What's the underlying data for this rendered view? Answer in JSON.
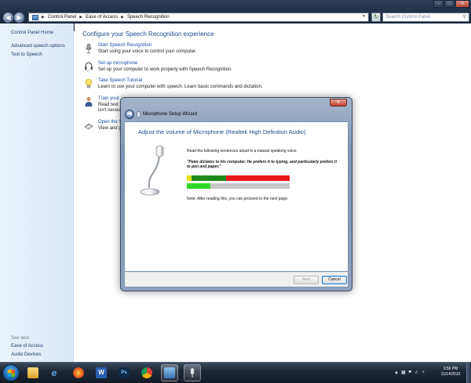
{
  "window": {
    "breadcrumb": [
      "Control Panel",
      "Ease of Access",
      "Speech Recognition"
    ],
    "search_placeholder": "Search Control Panel"
  },
  "sidebar": {
    "home": "Control Panel Home",
    "items": [
      "Advanced speech options",
      "Text to Speech"
    ],
    "see_also_label": "See also",
    "see_also": [
      "Ease of Access",
      "Audio Devices"
    ]
  },
  "main": {
    "heading": "Configure your Speech Recognition experience",
    "tasks": [
      {
        "title": "Start Speech Recognition",
        "desc": "Start using your voice to control your computer.",
        "icon": "microphone-icon"
      },
      {
        "title": "Set up microphone",
        "desc": "Set up your computer to work properly with Speech Recognition.",
        "icon": "headset-icon"
      },
      {
        "title": "Take Speech Tutorial",
        "desc": "Learn to use your computer with speech.  Learn basic commands and dictation.",
        "icon": "lightbulb-icon"
      },
      {
        "title": "Train your",
        "desc": "Read text to",
        "desc2": "isn't necess",
        "icon": "person-icon"
      },
      {
        "title": "Open the S",
        "desc": "View and p",
        "icon": "card-icon"
      }
    ]
  },
  "dialog": {
    "title": "Microphone Setup Wizard",
    "heading": "Adjust the volume of Microphone (Realtek High Definition Audio)",
    "instruction": "Read the following sentences aloud in a natural speaking voice.",
    "quote": "\"Peter dictates to his computer. He prefers it to typing, and particularly prefers it to pen and paper.\"",
    "note": "Note: After reading this, you can proceed to the next page.",
    "next_label": "Next",
    "cancel_label": "Cancel",
    "level_fraction": 0.23
  },
  "taskbar": {
    "apps": [
      "explorer-icon",
      "internet-explorer-icon",
      "firefox-icon",
      "word-icon",
      "photoshop-icon",
      "chrome-icon",
      "control-panel-icon",
      "speech-recognition-icon"
    ],
    "time": "3:56 PM",
    "date": "11/14/2010"
  },
  "colors": {
    "link_blue": "#1b4ea0",
    "heading_blue": "#1e4b8b",
    "meter_red": "#ea1818",
    "meter_green": "#1f8a1c",
    "meter_yellow": "#e5e20a",
    "level_green": "#2fd82a"
  }
}
